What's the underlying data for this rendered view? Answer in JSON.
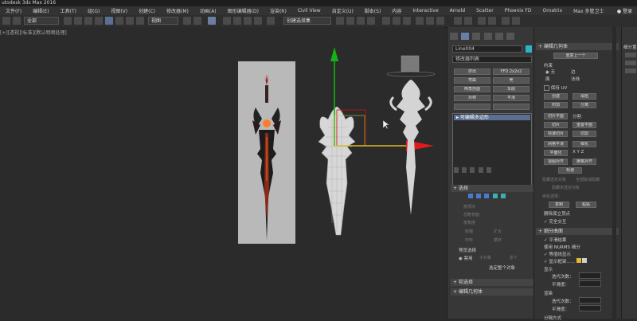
{
  "app": {
    "title": "utodesk 3ds Max 2016"
  },
  "menu": {
    "items": [
      "文件(F)",
      "编辑(E)",
      "工具(T)",
      "组(G)",
      "视图(V)",
      "创建(C)",
      "修改器(M)",
      "动画(A)",
      "图形编辑器(D)",
      "渲染(R)",
      "Civil View",
      "自定义(U)",
      "脚本(S)",
      "内容",
      "Interactive",
      "Arnold",
      "Scatter",
      "Phoenix FD",
      "Ornatrix",
      "Max 多管卫士"
    ],
    "user": "登录"
  },
  "toolbar": {
    "layer_select": "全部",
    "view_select": "视图",
    "selset_select": "创建选择集"
  },
  "viewport": {
    "label": "[+][透视][标准][默认明暗处理]"
  },
  "command_panel": {
    "object_name": "Line004",
    "modifier_list": "修改器列表",
    "buttons": [
      "挤出",
      "FFD 2x2x2",
      "弯曲",
      "壳",
      "倒角剖面",
      "车削",
      "对称",
      "平滑"
    ],
    "stack_item": "▸ 可编辑多边形",
    "selection_title": "选择",
    "selection_items": [
      "按顶点",
      "忽略背面",
      "按角度",
      "收缩",
      "扩大",
      "环形",
      "循环"
    ],
    "preview_label": "预览选择",
    "preview_options": [
      "禁用",
      "子对象",
      "多个"
    ],
    "selection_status": "选定整个对象",
    "soft_sel": "软选择",
    "edit_geo": "编辑几何体"
  },
  "panel3": {
    "title": "编辑几何体",
    "repeat": "重复上一个",
    "constraints": "约束",
    "constraint_opts": [
      "无",
      "边",
      "面",
      "法线"
    ],
    "preserve_uvs": "保持 UV",
    "create": "创建",
    "collapse": "塌陷",
    "attach": "附加",
    "detach": "分离",
    "slice_plane": "切片平面",
    "split": "分割",
    "slice": "切片",
    "reset_plane": "重置平面",
    "quickslice": "快速切片",
    "cut": "切割",
    "meshsmooth": "网格平滑",
    "tessellate": "细化",
    "planarize": "平面化",
    "view_align": "视图对齐",
    "grid_align": "栅格对齐",
    "relax": "松弛",
    "hide_sel": "隐藏选定对象",
    "unhide_all": "全部取消隐藏",
    "hide_unsel": "隐藏未选定对象",
    "named_sel": "命名选择：",
    "copy": "复制",
    "paste": "粘贴",
    "delete_iso": "删除孤立顶点",
    "full_interactivity": "完全交互",
    "subdiv_title": "细分曲面",
    "smooth_result": "平滑结果",
    "use_nurms": "使用 NURMS 细分",
    "isoline": "等值线显示",
    "show_cage": "显示框架......",
    "display": "显示",
    "iterations": "迭代次数：",
    "smoothness": "平滑度：",
    "render": "渲染",
    "sep_by": "分隔方式"
  },
  "panel4": {
    "title": "细分置"
  },
  "colors": {
    "accent_blue": "#5b6f92",
    "cage_yellow": "#e6b62c",
    "gizmo_green": "#13b313",
    "gizmo_red": "#e01b1b"
  }
}
